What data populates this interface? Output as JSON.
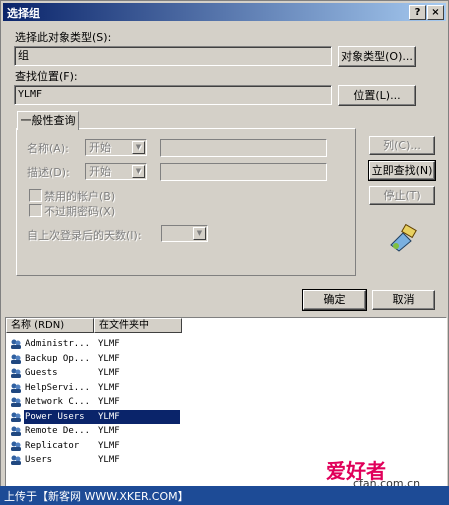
{
  "window": {
    "title": "选择组",
    "help_btn": "?",
    "close_btn": "×"
  },
  "object_type": {
    "label": "选择此对象类型(S):",
    "value": "组",
    "button": "对象类型(O)..."
  },
  "location": {
    "label": "查找位置(F):",
    "value": "YLMF",
    "button": "位置(L)..."
  },
  "query": {
    "tab": "一般性查询",
    "name_label": "名称(A):",
    "name_combo": "开始",
    "desc_label": "描述(D):",
    "desc_combo": "开始",
    "disabled_accounts": "禁用的帐户(B)",
    "no_expire": "不过期密码(X)",
    "days_label": "自上次登录后的天数(I):"
  },
  "side": {
    "columns": "列(C)...",
    "find_now": "立即查找(N)",
    "stop": "停止(T)"
  },
  "footer": {
    "ok": "确定",
    "cancel": "取消"
  },
  "results": {
    "headers": [
      "名称 (RDN)",
      "在文件夹中"
    ],
    "rows": [
      {
        "name": "Administr...",
        "folder": "YLMF"
      },
      {
        "name": "Backup Op...",
        "folder": "YLMF"
      },
      {
        "name": "Guests",
        "folder": "YLMF"
      },
      {
        "name": "HelpServi...",
        "folder": "YLMF"
      },
      {
        "name": "Network C...",
        "folder": "YLMF"
      },
      {
        "name": "Power Users",
        "folder": "YLMF"
      },
      {
        "name": "Remote De...",
        "folder": "YLMF"
      },
      {
        "name": "Replicator",
        "folder": "YLMF"
      },
      {
        "name": "Users",
        "folder": "YLMF"
      }
    ],
    "selected_index": 5
  },
  "watermark": {
    "upload_text": "上传于【新客网 WWW.XKER.COM】",
    "brand": "爱好者",
    "site": "cfan.com.cn"
  }
}
